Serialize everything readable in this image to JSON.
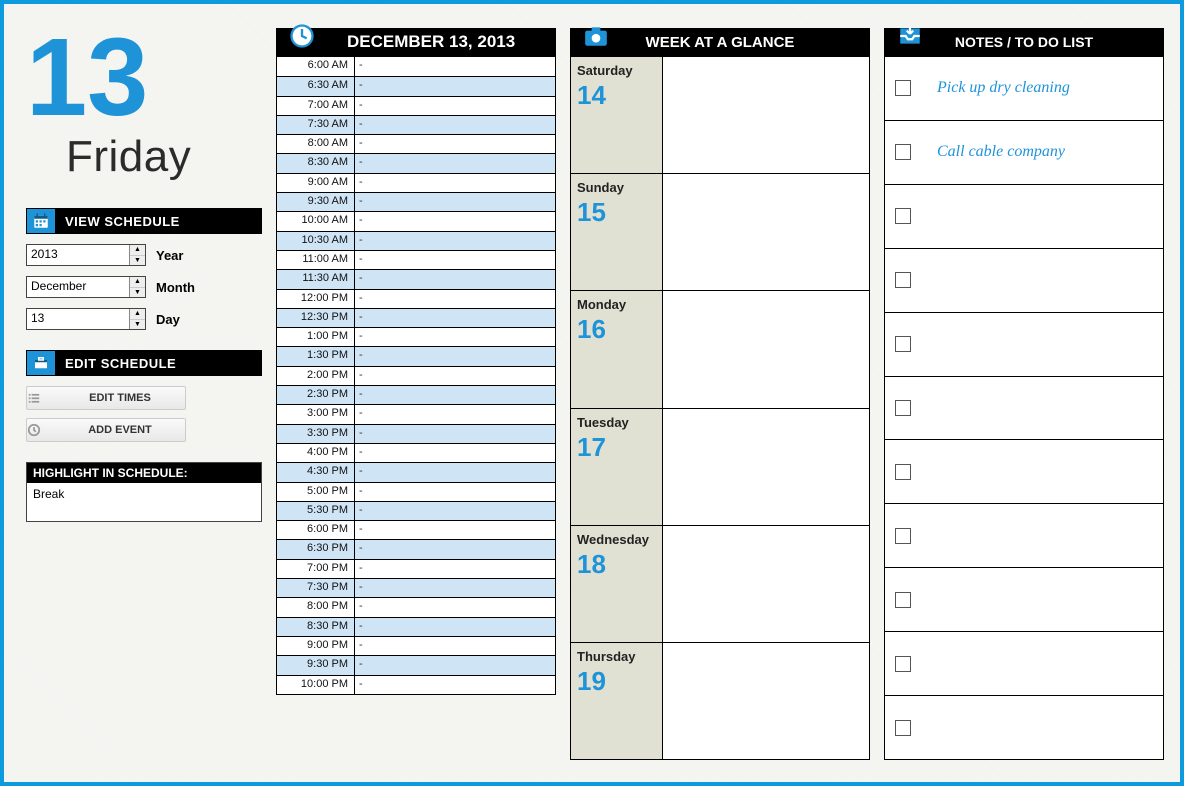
{
  "date": {
    "number": "13",
    "dayname": "Friday",
    "full": "DECEMBER 13, 2013"
  },
  "sidebar": {
    "view_schedule_label": "VIEW SCHEDULE",
    "year": {
      "value": "2013",
      "label": "Year"
    },
    "month": {
      "value": "December",
      "label": "Month"
    },
    "day": {
      "value": "13",
      "label": "Day"
    },
    "edit_schedule_label": "EDIT SCHEDULE",
    "edit_times_btn": "EDIT TIMES",
    "add_event_btn": "ADD EVENT",
    "highlight_header": "HIGHLIGHT IN SCHEDULE:",
    "highlight_value": "Break"
  },
  "schedule": {
    "rows": [
      {
        "time": "6:00 AM",
        "event": "-"
      },
      {
        "time": "6:30 AM",
        "event": "-"
      },
      {
        "time": "7:00 AM",
        "event": "-"
      },
      {
        "time": "7:30 AM",
        "event": "-"
      },
      {
        "time": "8:00 AM",
        "event": "-"
      },
      {
        "time": "8:30 AM",
        "event": "-"
      },
      {
        "time": "9:00 AM",
        "event": "-"
      },
      {
        "time": "9:30 AM",
        "event": "-"
      },
      {
        "time": "10:00 AM",
        "event": "-"
      },
      {
        "time": "10:30 AM",
        "event": "-"
      },
      {
        "time": "11:00 AM",
        "event": "-"
      },
      {
        "time": "11:30 AM",
        "event": "-"
      },
      {
        "time": "12:00 PM",
        "event": "-"
      },
      {
        "time": "12:30 PM",
        "event": "-"
      },
      {
        "time": "1:00 PM",
        "event": "-"
      },
      {
        "time": "1:30 PM",
        "event": "-"
      },
      {
        "time": "2:00 PM",
        "event": "-"
      },
      {
        "time": "2:30 PM",
        "event": "-"
      },
      {
        "time": "3:00 PM",
        "event": "-"
      },
      {
        "time": "3:30 PM",
        "event": "-"
      },
      {
        "time": "4:00 PM",
        "event": "-"
      },
      {
        "time": "4:30 PM",
        "event": "-"
      },
      {
        "time": "5:00 PM",
        "event": "-"
      },
      {
        "time": "5:30 PM",
        "event": "-"
      },
      {
        "time": "6:00 PM",
        "event": "-"
      },
      {
        "time": "6:30 PM",
        "event": "-"
      },
      {
        "time": "7:00 PM",
        "event": "-"
      },
      {
        "time": "7:30 PM",
        "event": "-"
      },
      {
        "time": "8:00 PM",
        "event": "-"
      },
      {
        "time": "8:30 PM",
        "event": "-"
      },
      {
        "time": "9:00 PM",
        "event": "-"
      },
      {
        "time": "9:30 PM",
        "event": "-"
      },
      {
        "time": "10:00 PM",
        "event": "-"
      }
    ]
  },
  "week": {
    "title": "WEEK AT A GLANCE",
    "days": [
      {
        "name": "Saturday",
        "num": "14"
      },
      {
        "name": "Sunday",
        "num": "15"
      },
      {
        "name": "Monday",
        "num": "16"
      },
      {
        "name": "Tuesday",
        "num": "17"
      },
      {
        "name": "Wednesday",
        "num": "18"
      },
      {
        "name": "Thursday",
        "num": "19"
      }
    ]
  },
  "notes": {
    "title": "NOTES / TO DO LIST",
    "items": [
      {
        "text": "Pick up dry cleaning"
      },
      {
        "text": "Call cable company"
      },
      {
        "text": ""
      },
      {
        "text": ""
      },
      {
        "text": ""
      },
      {
        "text": ""
      },
      {
        "text": ""
      },
      {
        "text": ""
      },
      {
        "text": ""
      },
      {
        "text": ""
      },
      {
        "text": ""
      }
    ]
  }
}
